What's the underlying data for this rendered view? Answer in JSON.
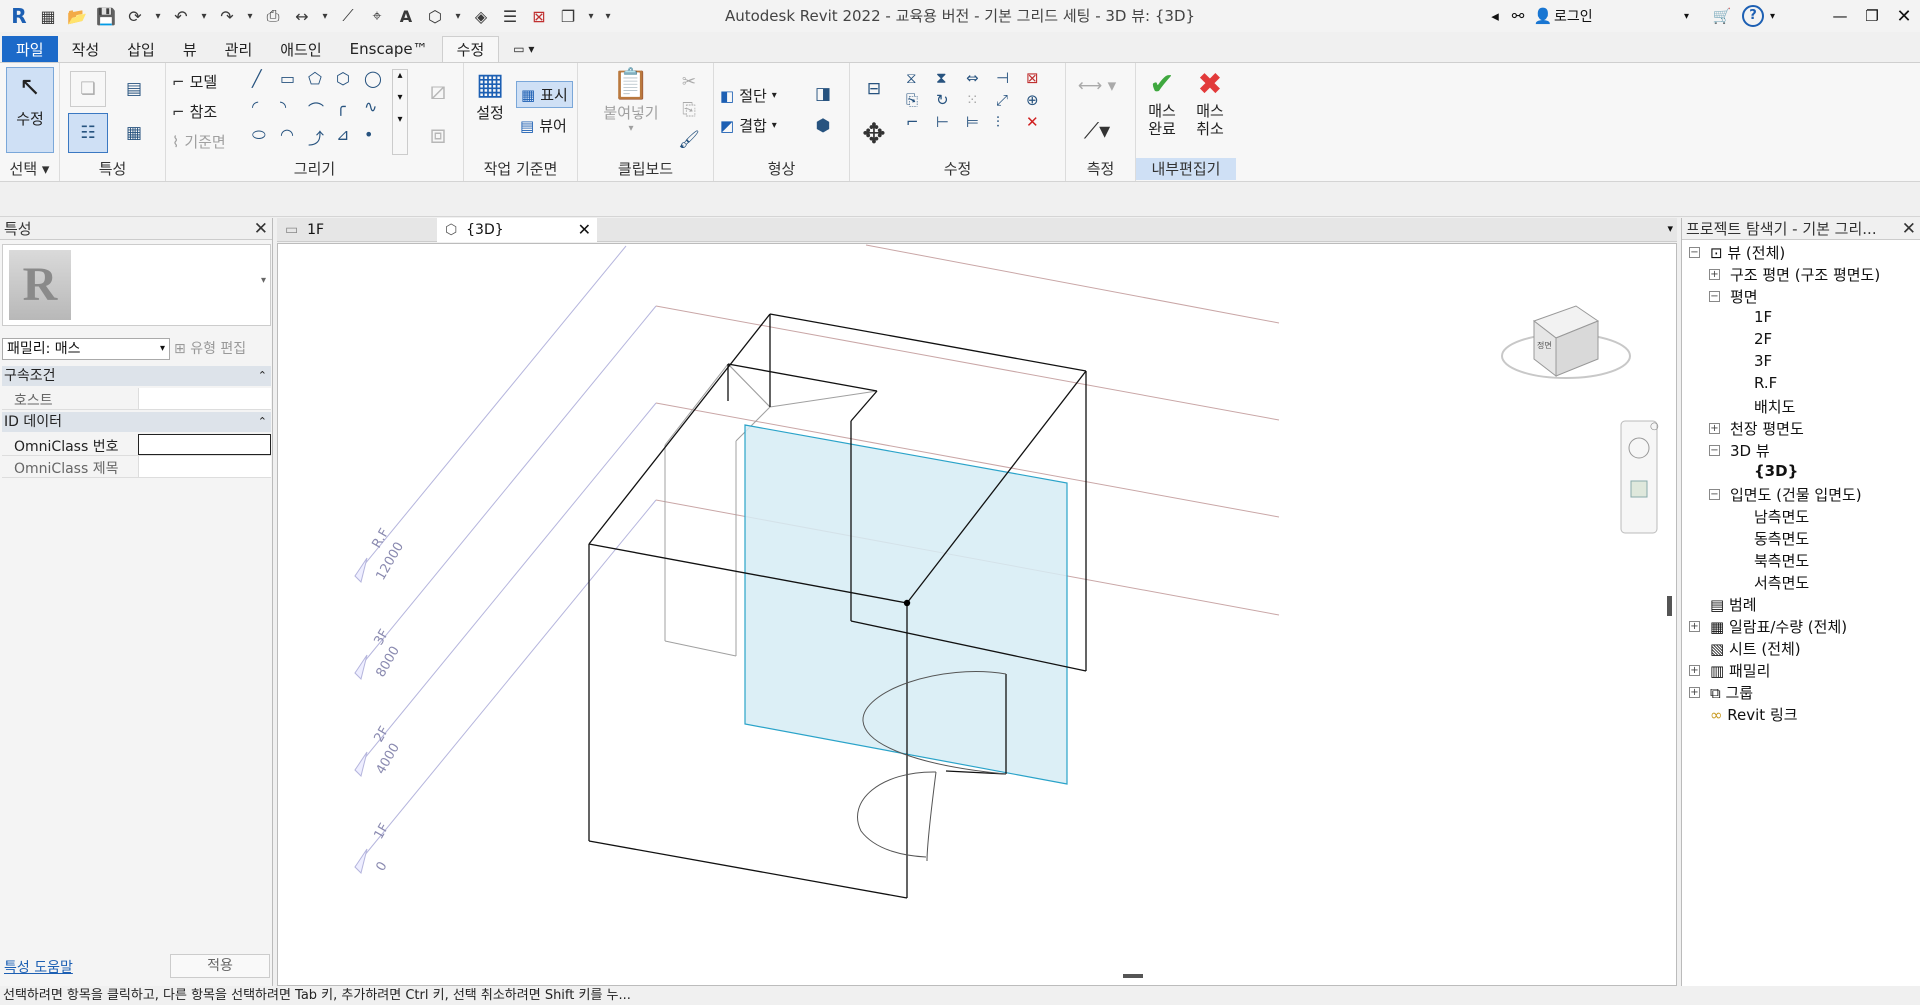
{
  "app": {
    "title": "Autodesk Revit 2022 - 교육용 버전 - 기본 그리드 세팅 - 3D 뷰: {3D}",
    "login_label": "로그인",
    "help_label": "?"
  },
  "menu_tabs": [
    "파일",
    "작성",
    "삽입",
    "뷰",
    "관리",
    "애드인",
    "Enscape™",
    "수정"
  ],
  "ribbon": {
    "select": {
      "modify_label": "수정",
      "panel_label": "선택"
    },
    "properties": {
      "panel_label": "특성"
    },
    "draw": {
      "model_label": "모델",
      "ref_label": "참조",
      "workplane_label": "기준면",
      "panel_label": "그리기"
    },
    "workplane": {
      "set_label": "설정",
      "show_label": "표시",
      "viewer_label": "뷰어",
      "panel_label": "작업 기준면"
    },
    "clipboard": {
      "paste_label": "붙여넣기",
      "panel_label": "클립보드"
    },
    "geometry": {
      "cut_label": "절단",
      "join_label": "결합",
      "panel_label": "형상"
    },
    "modify": {
      "panel_label": "수정"
    },
    "measure": {
      "panel_label": "측정"
    },
    "inplace": {
      "finish_label": "매스\n완료",
      "cancel_label": "매스\n취소",
      "finish_l1": "매스",
      "finish_l2": "완료",
      "cancel_l1": "매스",
      "cancel_l2": "취소",
      "panel_label": "내부편집기"
    }
  },
  "properties_palette": {
    "title": "특성",
    "family": "패밀리: 매스",
    "edit_type": "유형 편집",
    "sections": [
      {
        "name": "구속조건",
        "rows": [
          {
            "key": "호스트",
            "value": ""
          }
        ]
      },
      {
        "name": "ID 데이터",
        "rows": [
          {
            "key": "OmniClass 번호",
            "value": ""
          },
          {
            "key": "OmniClass 제목",
            "value": ""
          }
        ]
      }
    ],
    "help_link": "특성 도움말",
    "apply_label": "적용"
  },
  "view_tabs": [
    {
      "label": "1F"
    },
    {
      "label": "{3D}"
    }
  ],
  "levels": [
    {
      "name": "R.F",
      "elevation": "12000"
    },
    {
      "name": "3F",
      "elevation": "8000"
    },
    {
      "name": "2F",
      "elevation": "4000"
    },
    {
      "name": "1F",
      "elevation": "0"
    }
  ],
  "project_browser": {
    "title": "프로젝트 탐색기 - 기본 그리...",
    "nodes": [
      {
        "label": "뷰 (전체)",
        "toggle": "−"
      },
      {
        "label": "구조 평면 (구조 평면도)",
        "toggle": "+"
      },
      {
        "label": "평면",
        "toggle": "−"
      },
      {
        "label": "1F"
      },
      {
        "label": "2F"
      },
      {
        "label": "3F"
      },
      {
        "label": "R.F"
      },
      {
        "label": "배치도"
      },
      {
        "label": "천장 평면도",
        "toggle": "+"
      },
      {
        "label": "3D 뷰",
        "toggle": "−"
      },
      {
        "label": "{3D}"
      },
      {
        "label": "입면도 (건물 입면도)",
        "toggle": "−"
      },
      {
        "label": "남측면도"
      },
      {
        "label": "동측면도"
      },
      {
        "label": "북측면도"
      },
      {
        "label": "서측면도"
      },
      {
        "label": "범례"
      },
      {
        "label": "일람표/수량 (전체)",
        "toggle": "+"
      },
      {
        "label": "시트 (전체)"
      },
      {
        "label": "패밀리",
        "toggle": "+"
      },
      {
        "label": "그룹",
        "toggle": "+"
      },
      {
        "label": "Revit 링크"
      }
    ]
  },
  "viewcube_labels": {
    "front": "정면"
  },
  "status": "선택하려면 항목을 클릭하고, 다른 항목을 선택하려면 Tab 키, 추가하려면 Ctrl 키, 선택 취소하려면 Shift 키를 누...",
  "colors": {
    "file_tab": "#1c6ac9",
    "workplane_fill": "#d6ecf5",
    "workplane_stroke": "#2aa3c9",
    "level_line": "#7f7fbf"
  }
}
